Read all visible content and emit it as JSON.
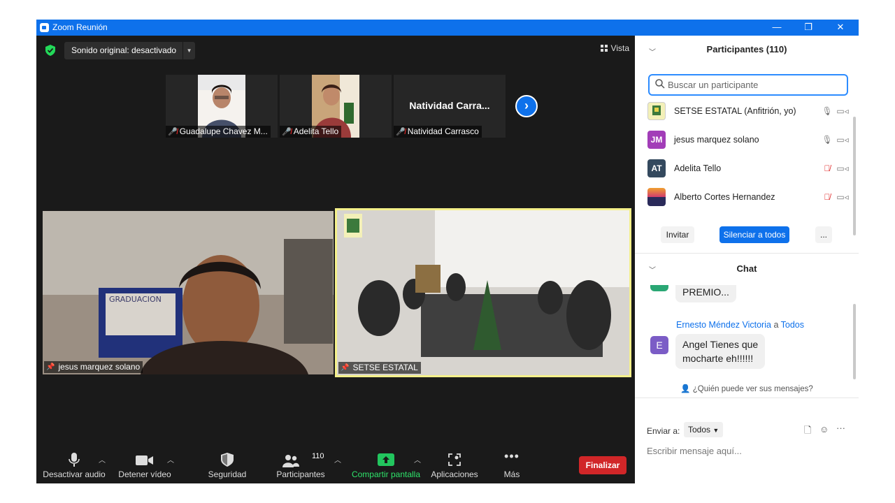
{
  "window": {
    "title": "Zoom Reunión",
    "minimize": "—",
    "restore": "❐",
    "close": "✕"
  },
  "meeting": {
    "sound_label": "Sonido original: desactivado",
    "view_label": "Vista",
    "thumbnails": [
      {
        "name": "Guadalupe Chavez M..."
      },
      {
        "name": "Adelita Tello"
      },
      {
        "name": "Natividad Carrasco",
        "display": "Natividad  Carra..."
      }
    ],
    "videos": [
      {
        "name": "jesus marquez solano"
      },
      {
        "name": "SETSE ESTATAL"
      }
    ],
    "room_sign": "GRADUACION"
  },
  "toolbar": {
    "mute": "Desactivar audio",
    "video": "Detener vídeo",
    "security": "Seguridad",
    "participants": "Participantes",
    "participants_count": "110",
    "share": "Compartir pantalla",
    "apps": "Aplicaciones",
    "more": "Más",
    "end": "Finalizar"
  },
  "participants_panel": {
    "title": "Participantes (110)",
    "search_placeholder": "Buscar un participante",
    "rows": [
      {
        "name": "SETSE ESTATAL (Anfitrión, yo)",
        "initials": "",
        "color": "#f3f0b8",
        "muted": false
      },
      {
        "name": "jesus marquez solano",
        "initials": "JM",
        "color": "#a23db8",
        "muted": false
      },
      {
        "name": "Adelita Tello",
        "initials": "AT",
        "color": "#34495e",
        "muted": true
      },
      {
        "name": "Alberto Cortes Hernandez",
        "initials": "",
        "color": "#2a2a5a",
        "muted": true
      }
    ],
    "invite": "Invitar",
    "mute_all": "Silenciar a todos",
    "more": "..."
  },
  "chat": {
    "title": "Chat",
    "prev_message": "PREMIO...",
    "sender": "Ernesto Méndez Victoria",
    "to_word": "a",
    "recipient": "Todos",
    "sender_initial": "E",
    "message_line1": "Angel Tienes que",
    "message_line2": "mocharte eh!!!!!!",
    "who_can_see": "¿Quién puede ver sus mensajes?",
    "send_to_label": "Enviar a:",
    "send_to_value": "Todos",
    "input_placeholder": "Escribir mensaje aquí..."
  },
  "colors": {
    "accent": "#0e71eb",
    "end_button": "#d12628",
    "share_green": "#22c55e",
    "active_speaker": "#f4f08a"
  }
}
